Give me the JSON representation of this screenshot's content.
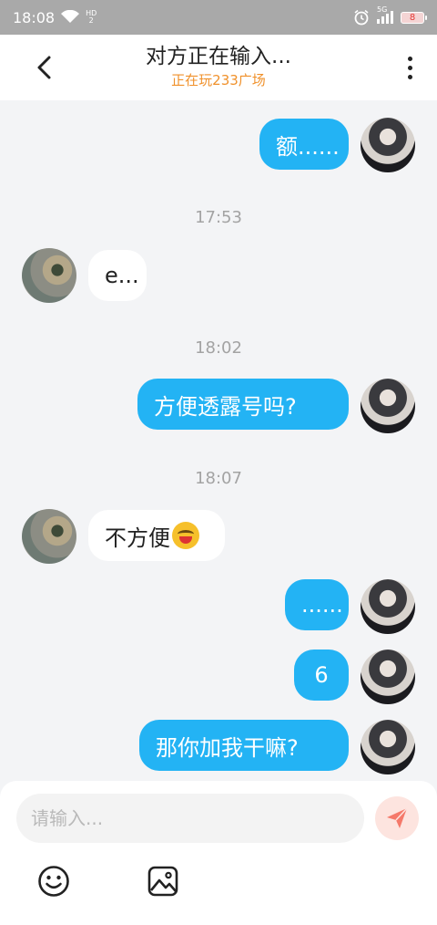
{
  "status_bar": {
    "time": "18:08",
    "network_badge_top": "HD",
    "network_badge_bottom": "2",
    "signal_label": "5G",
    "battery": "8"
  },
  "header": {
    "title": "对方正在输入...",
    "subtitle": "正在玩233广场"
  },
  "messages": [
    {
      "from": "me",
      "text": "额......"
    },
    {
      "from": "time",
      "text": "17:53"
    },
    {
      "from": "other",
      "text": "e..."
    },
    {
      "from": "time",
      "text": "18:02"
    },
    {
      "from": "me",
      "text": "方便透露号吗?"
    },
    {
      "from": "time",
      "text": "18:07"
    },
    {
      "from": "other",
      "text": "不方便",
      "emoji": "grinning-face-emoji"
    },
    {
      "from": "me",
      "text": "......"
    },
    {
      "from": "me",
      "text": "6"
    },
    {
      "from": "me",
      "text": "那你加我干嘛?"
    }
  ],
  "input": {
    "placeholder": "请输入..."
  },
  "icons": {
    "back": "chevron-left-icon",
    "more": "more-vertical-icon",
    "send": "send-icon",
    "emoji": "smiley-icon",
    "image": "image-icon"
  },
  "colors": {
    "accent_bubble": "#23b3f4",
    "subtitle": "#f0912b",
    "send_button": "#f5796a"
  }
}
